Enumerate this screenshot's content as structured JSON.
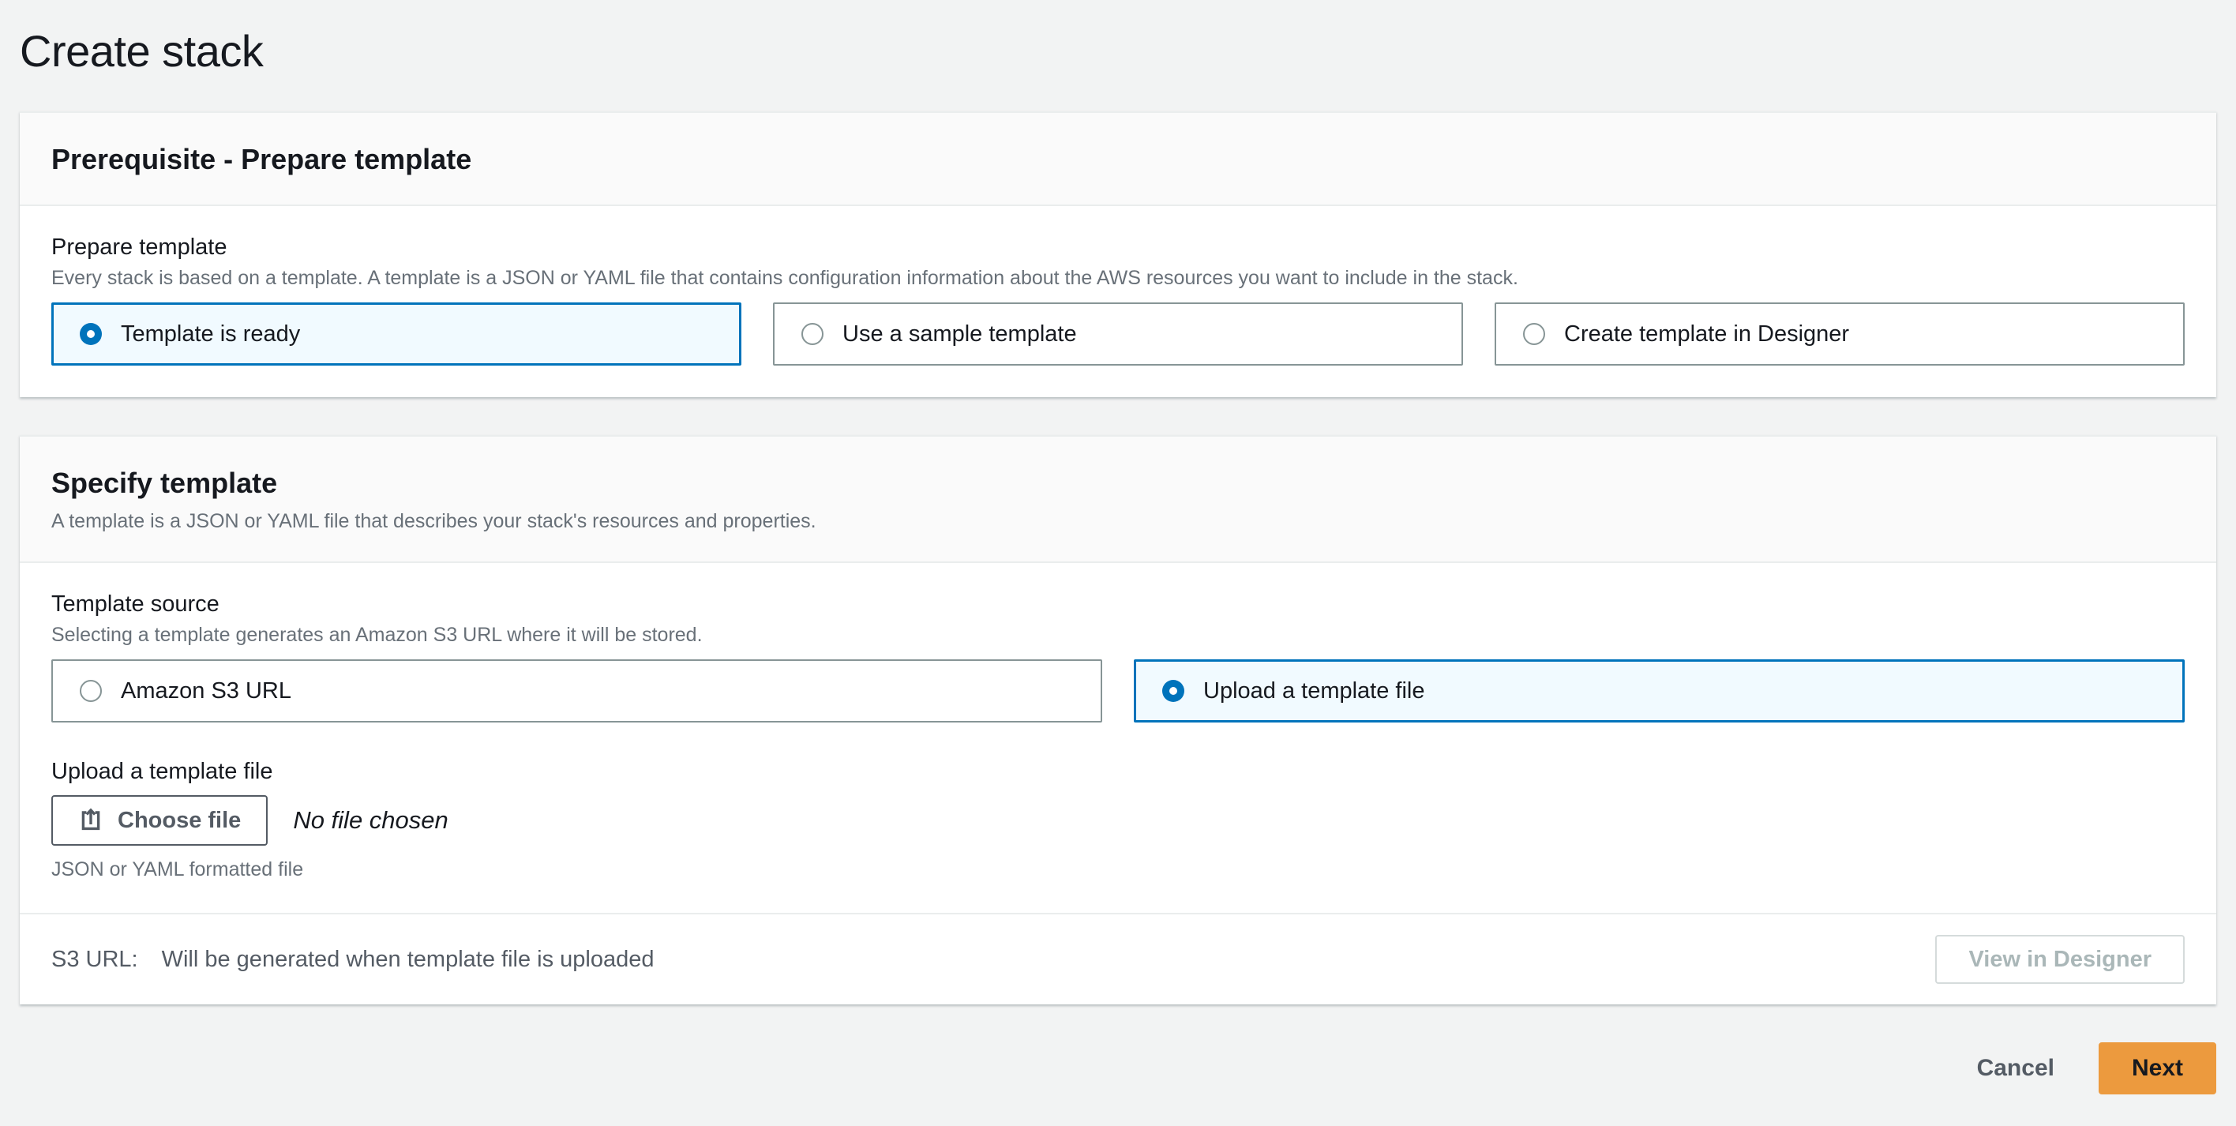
{
  "page": {
    "title": "Create stack"
  },
  "prerequisite_panel": {
    "title": "Prerequisite - Prepare template",
    "prepare_template": {
      "label": "Prepare template",
      "description": "Every stack is based on a template. A template is a JSON or YAML file that contains configuration information about the AWS resources you want to include in the stack.",
      "options": [
        {
          "label": "Template is ready",
          "selected": true
        },
        {
          "label": "Use a sample template",
          "selected": false
        },
        {
          "label": "Create template in Designer",
          "selected": false
        }
      ]
    }
  },
  "specify_panel": {
    "title": "Specify template",
    "description": "A template is a JSON or YAML file that describes your stack's resources and properties.",
    "template_source": {
      "label": "Template source",
      "description": "Selecting a template generates an Amazon S3 URL where it will be stored.",
      "options": [
        {
          "label": "Amazon S3 URL",
          "selected": false
        },
        {
          "label": "Upload a template file",
          "selected": true
        }
      ]
    },
    "upload": {
      "label": "Upload a template file",
      "choose_file_label": "Choose file",
      "file_status": "No file chosen",
      "hint": "JSON or YAML formatted file"
    },
    "footer": {
      "s3_label": "S3 URL:",
      "s3_value": "Will be generated when template file is uploaded",
      "view_designer_label": "View in Designer"
    }
  },
  "actions": {
    "cancel_label": "Cancel",
    "next_label": "Next"
  },
  "colors": {
    "page_background": "#f2f3f3",
    "accent_blue": "#0073bb",
    "selected_tile_bg": "#f1faff",
    "primary_button_bg": "#ec9a3e",
    "secondary_text": "#687078",
    "disabled_text": "#aab7b8"
  }
}
